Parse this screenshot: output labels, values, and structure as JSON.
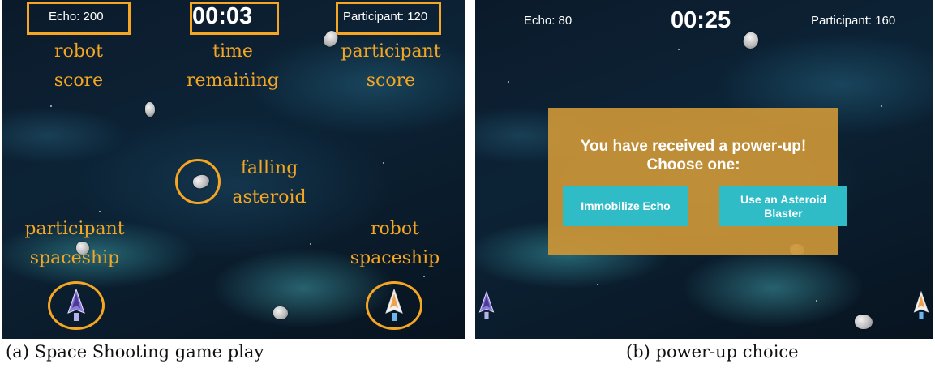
{
  "panel_a": {
    "hud": {
      "robot_score": "Echo: 200",
      "timer": "00:03",
      "participant_score": "Participant: 120"
    },
    "annotations": {
      "robot_score": "robot\nscore",
      "time_remaining": "time\nremaining",
      "participant_score": "participant\nscore",
      "falling_asteroid": "falling\nasteroid",
      "participant_spaceship": "participant\nspaceship",
      "robot_spaceship": "robot\nspaceship"
    },
    "caption": "(a) Space Shooting game play"
  },
  "panel_b": {
    "hud": {
      "robot_score": "Echo: 80",
      "timer": "00:25",
      "participant_score": "Participant: 160"
    },
    "dialog": {
      "title": "You have received a power-up!\nChoose one:",
      "option_1": "Immobilize Echo",
      "option_2": "Use an Asteroid\nBlaster"
    },
    "caption": "(b) power-up choice"
  },
  "colors": {
    "annotation": "#f5a623",
    "dialog_bg": "#cd9637",
    "button_bg": "#2fbcc7"
  }
}
